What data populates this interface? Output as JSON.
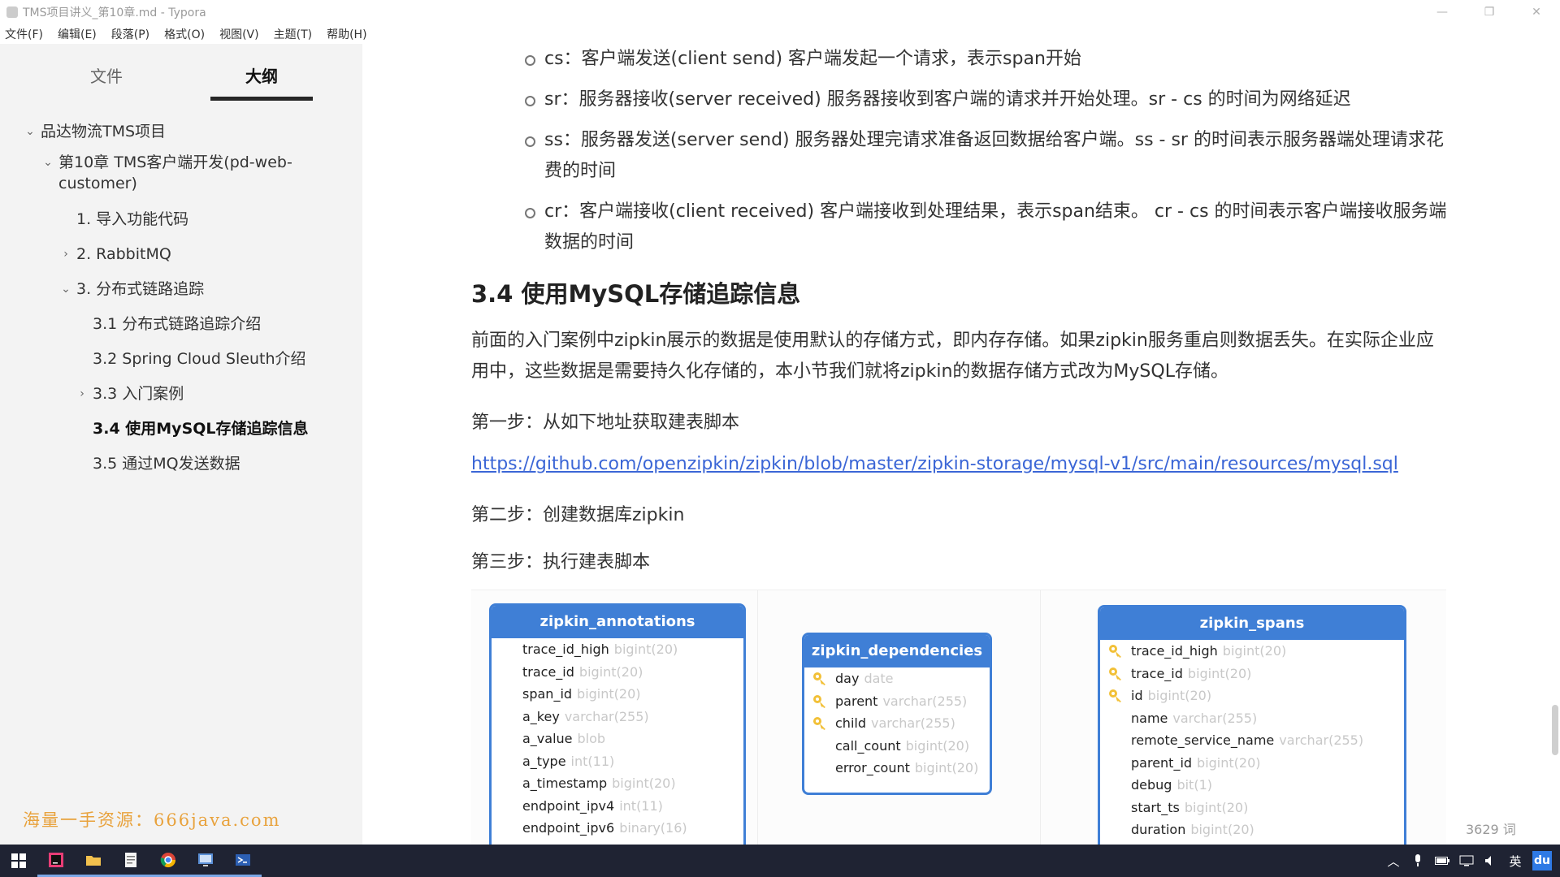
{
  "window": {
    "title": "TMS项目讲义_第10章.md - Typora"
  },
  "menu": [
    "文件(F)",
    "编辑(E)",
    "段落(P)",
    "格式(O)",
    "视图(V)",
    "主题(T)",
    "帮助(H)"
  ],
  "sidebar": {
    "tabs": [
      "文件",
      "大纲"
    ],
    "outline": [
      "品达物流TMS项目",
      "第10章 TMS客户端开发(pd-web-customer)",
      "1. 导入功能代码",
      "2. RabbitMQ",
      "3. 分布式链路追踪",
      "3.1 分布式链路追踪介绍",
      "3.2 Spring Cloud Sleuth介绍",
      "3.3 入门案例",
      "3.4 使用MySQL存储追踪信息",
      "3.5 通过MQ发送数据"
    ],
    "watermark": "海量一手资源：666java.com",
    "footer": {
      "back": "‹",
      "source": "</>"
    }
  },
  "content": {
    "bullets": [
      "cs：客户端发送(client send) 客户端发起一个请求，表示span开始",
      "sr：服务器接收(server received) 服务器接收到客户端的请求并开始处理。sr - cs 的时间为网络延迟",
      "ss：服务器发送(server send) 服务器处理完请求准备返回数据给客户端。ss - sr 的时间表示服务器端处理请求花费的时间",
      "cr：客户端接收(client received) 客户端接收到处理结果，表示span结束。 cr - cs 的时间表示客户端接收服务端数据的时间"
    ],
    "heading": "3.4 使用MySQL存储追踪信息",
    "paragraph": "前面的入门案例中zipkin展示的数据是使用默认的存储方式，即内存存储。如果zipkin服务重启则数据丢失。在实际企业应用中，这些数据是需要持久化存储的，本小节我们就将zipkin的数据存储方式改为MySQL存储。",
    "step1": "第一步：从如下地址获取建表脚本",
    "link": "https://github.com/openzipkin/zipkin/blob/master/zipkin-storage/mysql-v1/src/main/resources/mysql.sql",
    "step2": "第二步：创建数据库zipkin",
    "step3": "第三步：执行建表脚本"
  },
  "diagram": {
    "tables": [
      {
        "name": "zipkin_annotations",
        "fields": [
          {
            "name": "trace_id_high",
            "type": "bigint(20)",
            "key": false
          },
          {
            "name": "trace_id",
            "type": "bigint(20)",
            "key": false
          },
          {
            "name": "span_id",
            "type": "bigint(20)",
            "key": false
          },
          {
            "name": "a_key",
            "type": "varchar(255)",
            "key": false
          },
          {
            "name": "a_value",
            "type": "blob",
            "key": false
          },
          {
            "name": "a_type",
            "type": "int(11)",
            "key": false
          },
          {
            "name": "a_timestamp",
            "type": "bigint(20)",
            "key": false
          },
          {
            "name": "endpoint_ipv4",
            "type": "int(11)",
            "key": false
          },
          {
            "name": "endpoint_ipv6",
            "type": "binary(16)",
            "key": false
          }
        ]
      },
      {
        "name": "zipkin_dependencies",
        "fields": [
          {
            "name": "day",
            "type": "date",
            "key": true
          },
          {
            "name": "parent",
            "type": "varchar(255)",
            "key": true
          },
          {
            "name": "child",
            "type": "varchar(255)",
            "key": true
          },
          {
            "name": "call_count",
            "type": "bigint(20)",
            "key": false
          },
          {
            "name": "error_count",
            "type": "bigint(20)",
            "key": false
          }
        ]
      },
      {
        "name": "zipkin_spans",
        "fields": [
          {
            "name": "trace_id_high",
            "type": "bigint(20)",
            "key": true
          },
          {
            "name": "trace_id",
            "type": "bigint(20)",
            "key": true
          },
          {
            "name": "id",
            "type": "bigint(20)",
            "key": true
          },
          {
            "name": "name",
            "type": "varchar(255)",
            "key": false
          },
          {
            "name": "remote_service_name",
            "type": "varchar(255)",
            "key": false
          },
          {
            "name": "parent_id",
            "type": "bigint(20)",
            "key": false
          },
          {
            "name": "debug",
            "type": "bit(1)",
            "key": false
          },
          {
            "name": "start_ts",
            "type": "bigint(20)",
            "key": false
          },
          {
            "name": "duration",
            "type": "bigint(20)",
            "key": false
          }
        ]
      }
    ]
  },
  "status": {
    "word_count": "3629 词"
  },
  "taskbar": {
    "apps": [
      "windows-start-icon",
      "intellij-icon",
      "file-explorer-icon",
      "notepad-icon",
      "chrome-icon",
      "remote-desktop-icon",
      "powershell-icon"
    ],
    "tray_lang": "英",
    "tray_app": "du"
  },
  "colors": {
    "accent": "#3f7fd6",
    "link": "#3b66d6",
    "watermark": "#e8a23c",
    "taskbar": "#1f2333"
  }
}
